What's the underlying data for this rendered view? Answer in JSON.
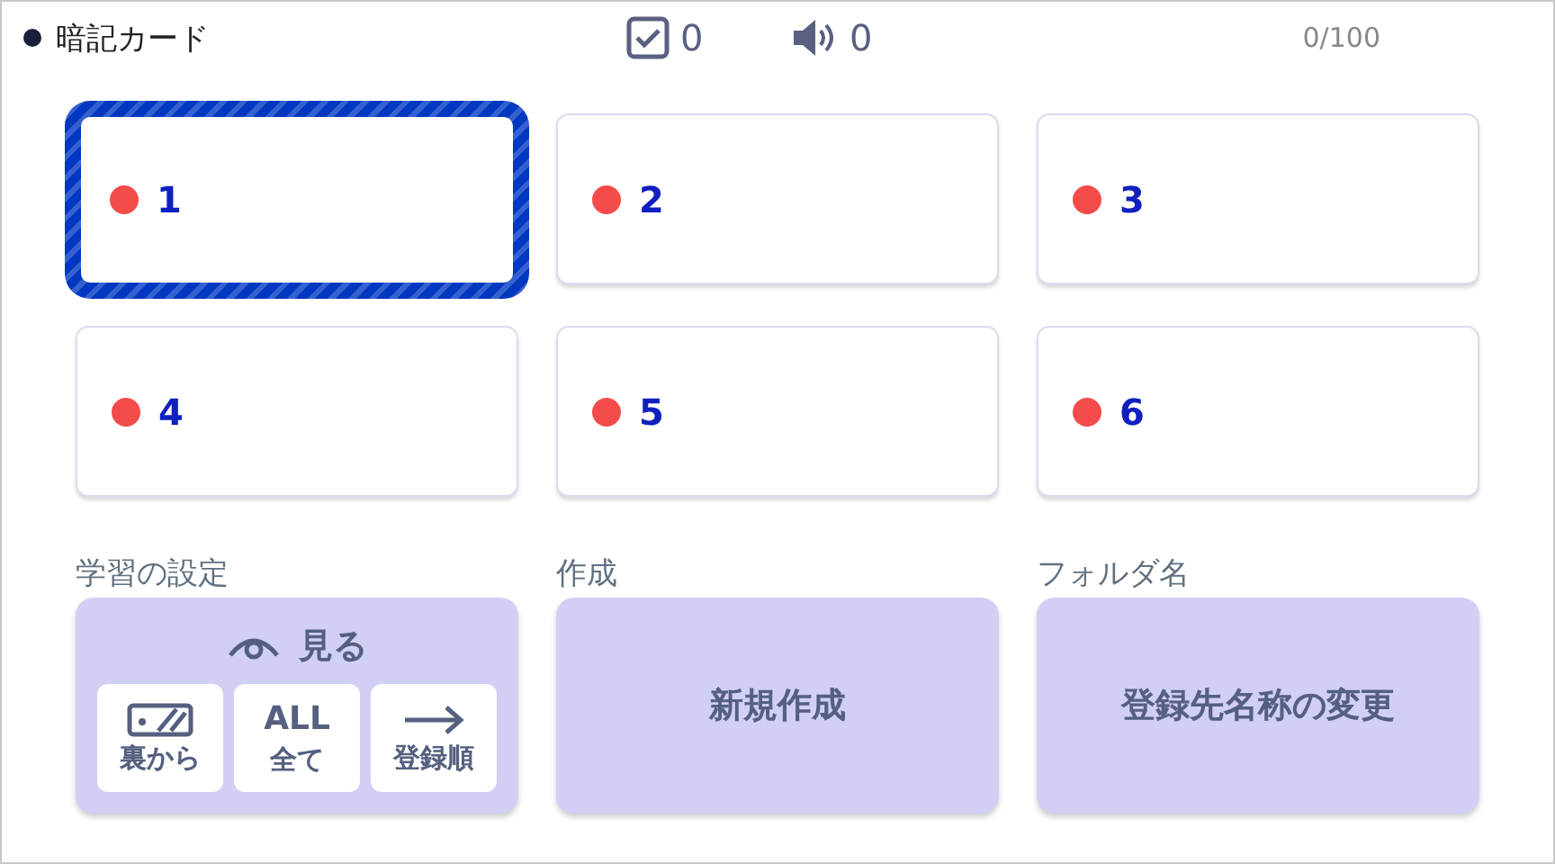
{
  "header": {
    "title": "暗記カード",
    "checked_count": "0",
    "audio_count": "0",
    "progress": "0/100"
  },
  "cards": [
    {
      "label": "1",
      "selected": true
    },
    {
      "label": "2",
      "selected": false
    },
    {
      "label": "3",
      "selected": false
    },
    {
      "label": "4",
      "selected": false
    },
    {
      "label": "5",
      "selected": false
    },
    {
      "label": "6",
      "selected": false
    }
  ],
  "sections": [
    {
      "label": "学習の設定",
      "kind": "study",
      "button": "見る",
      "options": [
        {
          "kind": "card",
          "label": "裏から"
        },
        {
          "kind": "text",
          "icon_text": "ALL",
          "label": "全て"
        },
        {
          "kind": "arrow",
          "label": "登録順"
        }
      ]
    },
    {
      "label": "作成",
      "kind": "plain",
      "button": "新規作成"
    },
    {
      "label": "フォルダ名",
      "kind": "plain",
      "button": "登録先名称の変更"
    }
  ]
}
